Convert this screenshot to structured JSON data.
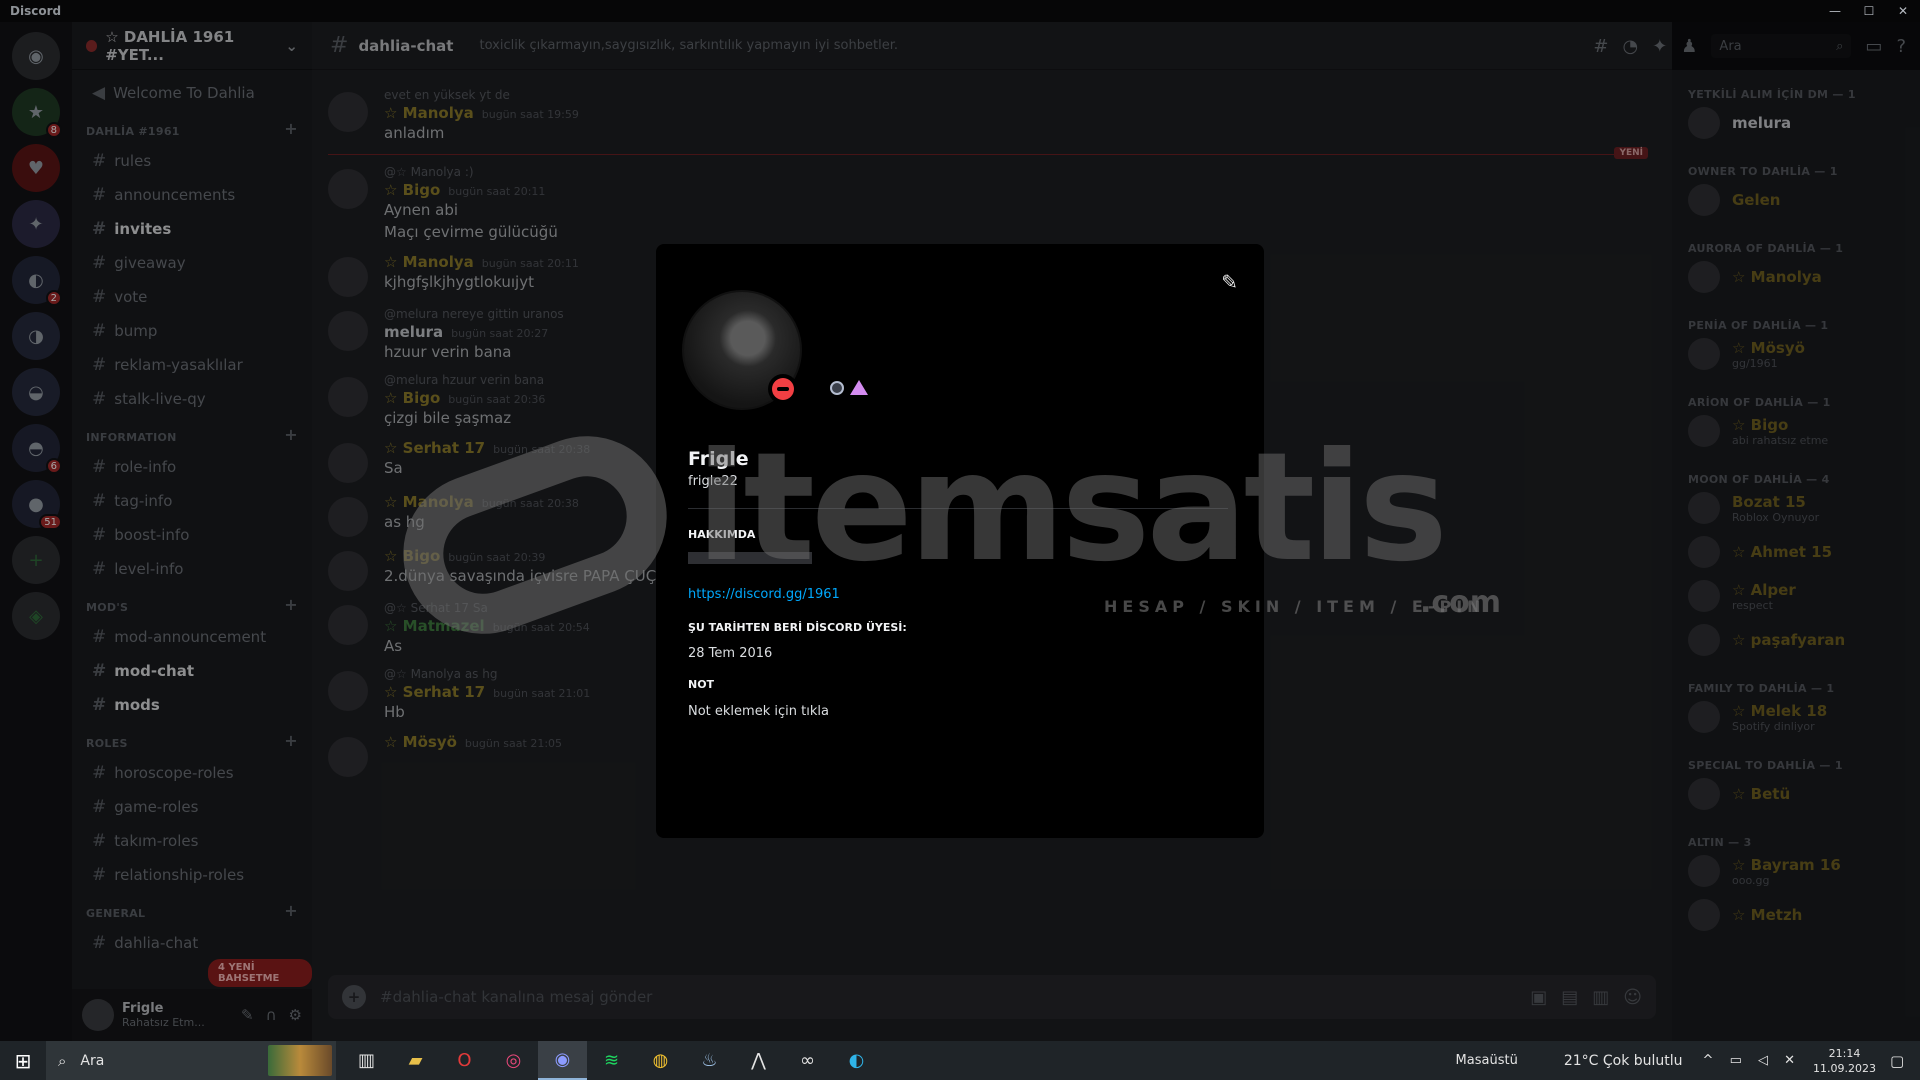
{
  "window": {
    "title": "Discord"
  },
  "server": {
    "name": "☆ DAHLİA 1961 #YET...",
    "welcome": "Welcome To Dahlia",
    "badges": [
      "8",
      "2",
      "6",
      "51"
    ]
  },
  "channels": {
    "categories": [
      {
        "name": "DAHLİA #1961",
        "items": [
          {
            "label": "rules",
            "bold": false
          },
          {
            "label": "announcements",
            "bold": false
          },
          {
            "label": "invites",
            "bold": true
          },
          {
            "label": "giveaway",
            "bold": false
          },
          {
            "label": "vote",
            "bold": false
          },
          {
            "label": "bump",
            "bold": false
          },
          {
            "label": "reklam-yasaklılar",
            "bold": false
          },
          {
            "label": "stalk-live-qy",
            "bold": false
          }
        ]
      },
      {
        "name": "INFORMATION",
        "items": [
          {
            "label": "role-info",
            "bold": false
          },
          {
            "label": "tag-info",
            "bold": false
          },
          {
            "label": "boost-info",
            "bold": false
          },
          {
            "label": "level-info",
            "bold": false
          }
        ]
      },
      {
        "name": "MOD'S",
        "items": [
          {
            "label": "mod-announcement",
            "bold": false
          },
          {
            "label": "mod-chat",
            "bold": true
          },
          {
            "label": "mods",
            "bold": true
          }
        ]
      },
      {
        "name": "ROLES",
        "items": [
          {
            "label": "horoscope-roles",
            "bold": false
          },
          {
            "label": "game-roles",
            "bold": false
          },
          {
            "label": "takım-roles",
            "bold": false
          },
          {
            "label": "relationship-roles",
            "bold": false
          }
        ]
      },
      {
        "name": "GENERAL",
        "items": [
          {
            "label": "dahlia-chat",
            "bold": false
          }
        ]
      }
    ],
    "new_mentions": "4 YENİ BAHSETME"
  },
  "user": {
    "name": "Frigle",
    "status": "Rahatsız Etm..."
  },
  "chat": {
    "channel": "dahlia-chat",
    "topic": "toxiclik çıkarmayın,saygısızlık, sarkıntılık yapmayın iyi sohbetler.",
    "search_placeholder": "Ara",
    "composer_placeholder": "#dahlia-chat kanalına mesaj gönder",
    "new_label": "YENİ",
    "messages": [
      {
        "reply": "evet en yüksek yt de",
        "author": "☆ Manolya",
        "time": "bugün saat 19:59",
        "text": "anladım",
        "color": "gold"
      },
      {
        "reply": "@☆ Manolya :)",
        "author": "☆ Bigo",
        "time": "bugün saat 20:11",
        "text": "Aynen abi\nMaçı çevirme gülücüğü",
        "color": "gold"
      },
      {
        "reply": "",
        "author": "☆ Manolya",
        "time": "bugün saat 20:11",
        "text": "kjhgfşlkjhygtlokuıjyt",
        "color": "gold"
      },
      {
        "reply": "@melura nereye gittin uranos",
        "author": "melura",
        "time": "bugün saat 20:27",
        "text": "hzuur verin bana",
        "color": "white"
      },
      {
        "reply": "@melura hzuur verin bana",
        "author": "☆ Bigo",
        "time": "bugün saat 20:36",
        "text": "çizgi bile şaşmaz",
        "color": "gold"
      },
      {
        "reply": "",
        "author": "☆ Serhat 17",
        "time": "bugün saat 20:38",
        "text": "Sa",
        "color": "gold"
      },
      {
        "reply": "",
        "author": "☆ Manolya",
        "time": "bugün saat 20:38",
        "text": "as hg",
        "color": "gold"
      },
      {
        "reply": "",
        "author": "☆ Bigo",
        "time": "bugün saat 20:39",
        "text": "2.dünya savaşında içvisre PAPA ÇUÇU PA...",
        "color": "gold"
      },
      {
        "reply": "@☆ Serhat 17 Sa",
        "author": "☆ Matmazel",
        "time": "bugün saat 20:54",
        "text": "As",
        "color": "green"
      },
      {
        "reply": "@☆ Manolya as hg",
        "author": "☆ Serhat 17",
        "time": "bugün saat 21:01",
        "text": "Hb",
        "color": "gold"
      },
      {
        "reply": "",
        "author": "☆ Mösyö",
        "time": "bugün saat 21:05",
        "text": "",
        "color": "gold"
      }
    ]
  },
  "members": {
    "groups": [
      {
        "name": "YETKİLİ ALIM İÇİN DM — 1",
        "members": [
          {
            "name": "melura",
            "sub": "",
            "white": true
          }
        ]
      },
      {
        "name": "OWNER TO DAHLİA — 1",
        "members": [
          {
            "name": "Gelen",
            "sub": "",
            "white": false
          }
        ]
      },
      {
        "name": "AURORA OF DAHLİA — 1",
        "members": [
          {
            "name": "☆ Manolya",
            "sub": "",
            "white": false
          }
        ]
      },
      {
        "name": "PENİA OF DAHLİA — 1",
        "members": [
          {
            "name": "☆ Mösyö",
            "sub": "gg/1961",
            "white": false
          }
        ]
      },
      {
        "name": "ARİON OF DAHLİA — 1",
        "members": [
          {
            "name": "☆ Bigo",
            "sub": "abi rahatsız etme",
            "white": false
          }
        ]
      },
      {
        "name": "MOON OF DAHLİA — 4",
        "members": [
          {
            "name": "Bozat 15",
            "sub": "Roblox Oynuyor",
            "white": false
          },
          {
            "name": "☆ Ahmet 15",
            "sub": "",
            "white": false
          },
          {
            "name": "☆ Alper",
            "sub": "respect",
            "white": false
          },
          {
            "name": "☆ paşafyaran",
            "sub": "",
            "white": false
          }
        ]
      },
      {
        "name": "FAMILY TO DAHLİA — 1",
        "members": [
          {
            "name": "☆ Melek 18",
            "sub": "Spotify dinliyor",
            "white": false
          }
        ]
      },
      {
        "name": "SPECIAL TO DAHLİA — 1",
        "members": [
          {
            "name": "☆ Betü",
            "sub": "",
            "white": false
          }
        ]
      },
      {
        "name": "ALTIN — 3",
        "members": [
          {
            "name": "☆ Bayram 16",
            "sub": "ooo.gg",
            "white": false
          },
          {
            "name": "☆ Metzh",
            "sub": "",
            "white": false
          }
        ]
      }
    ]
  },
  "profile": {
    "display_name": "Frigle",
    "username": "frigle22",
    "about_title": "HAKKIMDA",
    "about_link": "https://discord.gg/1961",
    "member_since_title": "ŞU TARİHTEN BERİ DİSCORD ÜYESİ:",
    "member_since": "28 Tem 2016",
    "note_title": "NOT",
    "note_placeholder": "Not eklemek için tıkla"
  },
  "watermark": {
    "brand": "itemsatis",
    "tagline": "HESAP / SKIN / ITEM / E-PIN",
    "domain": ".com"
  },
  "taskbar": {
    "search": "Ara",
    "desktop": "Masaüstü",
    "weather": "21°C  Çok bulutlu",
    "time": "21:14",
    "date": "11.09.2023"
  }
}
